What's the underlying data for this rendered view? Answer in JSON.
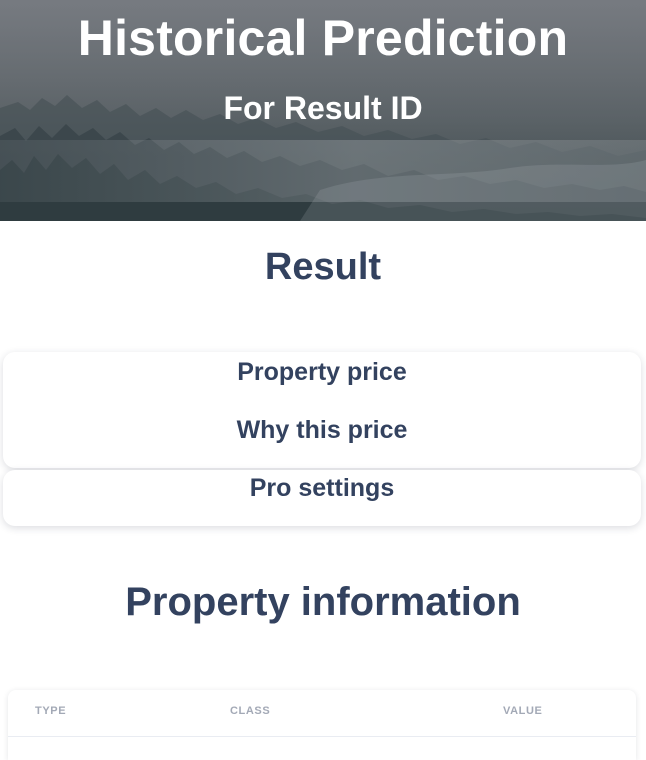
{
  "hero": {
    "title": "Historical Prediction",
    "subtitle": "For Result ID"
  },
  "result": {
    "title": "Result",
    "items": [
      {
        "label": "Property price"
      },
      {
        "label": "Why this price"
      },
      {
        "label": "Pro settings"
      }
    ]
  },
  "property_information": {
    "title": "Property information",
    "table": {
      "headers": [
        "TYPE",
        "CLASS",
        "VALUE"
      ],
      "rows": []
    }
  },
  "colors": {
    "heading": "#33425f",
    "table_header": "#a3a9b6",
    "background": "#ffffff"
  }
}
